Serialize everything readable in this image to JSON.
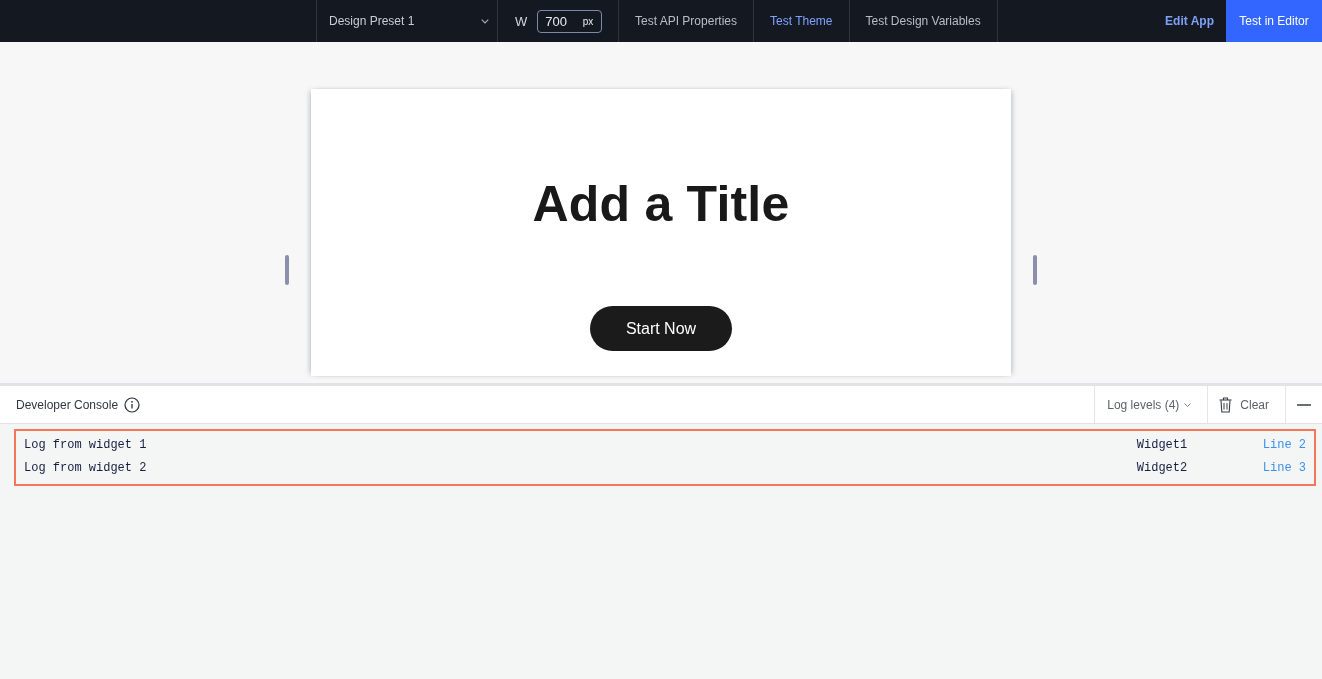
{
  "toolbar": {
    "preset_dropdown": {
      "value": "Design Preset 1"
    },
    "width_field": {
      "label": "W",
      "value": "700",
      "unit": "px"
    },
    "tabs": [
      {
        "label": "Test API Properties",
        "selected": false
      },
      {
        "label": "Test Theme",
        "selected": true
      },
      {
        "label": "Test Design Variables",
        "selected": false
      }
    ],
    "edit_app_link": "Edit App",
    "test_in_editor_button": "Test in Editor"
  },
  "preview": {
    "title": "Add a Title",
    "button": "Start Now"
  },
  "console": {
    "title": "Developer Console",
    "log_levels_button": "Log levels (4)",
    "clear_button": "Clear",
    "log_group": {
      "highlighted": true,
      "entries": [
        {
          "message": "Log from widget 1",
          "source": "Widget1",
          "line": "Line 2"
        },
        {
          "message": "Log from widget 2",
          "source": "Widget2",
          "line": "Line 3"
        }
      ]
    }
  }
}
